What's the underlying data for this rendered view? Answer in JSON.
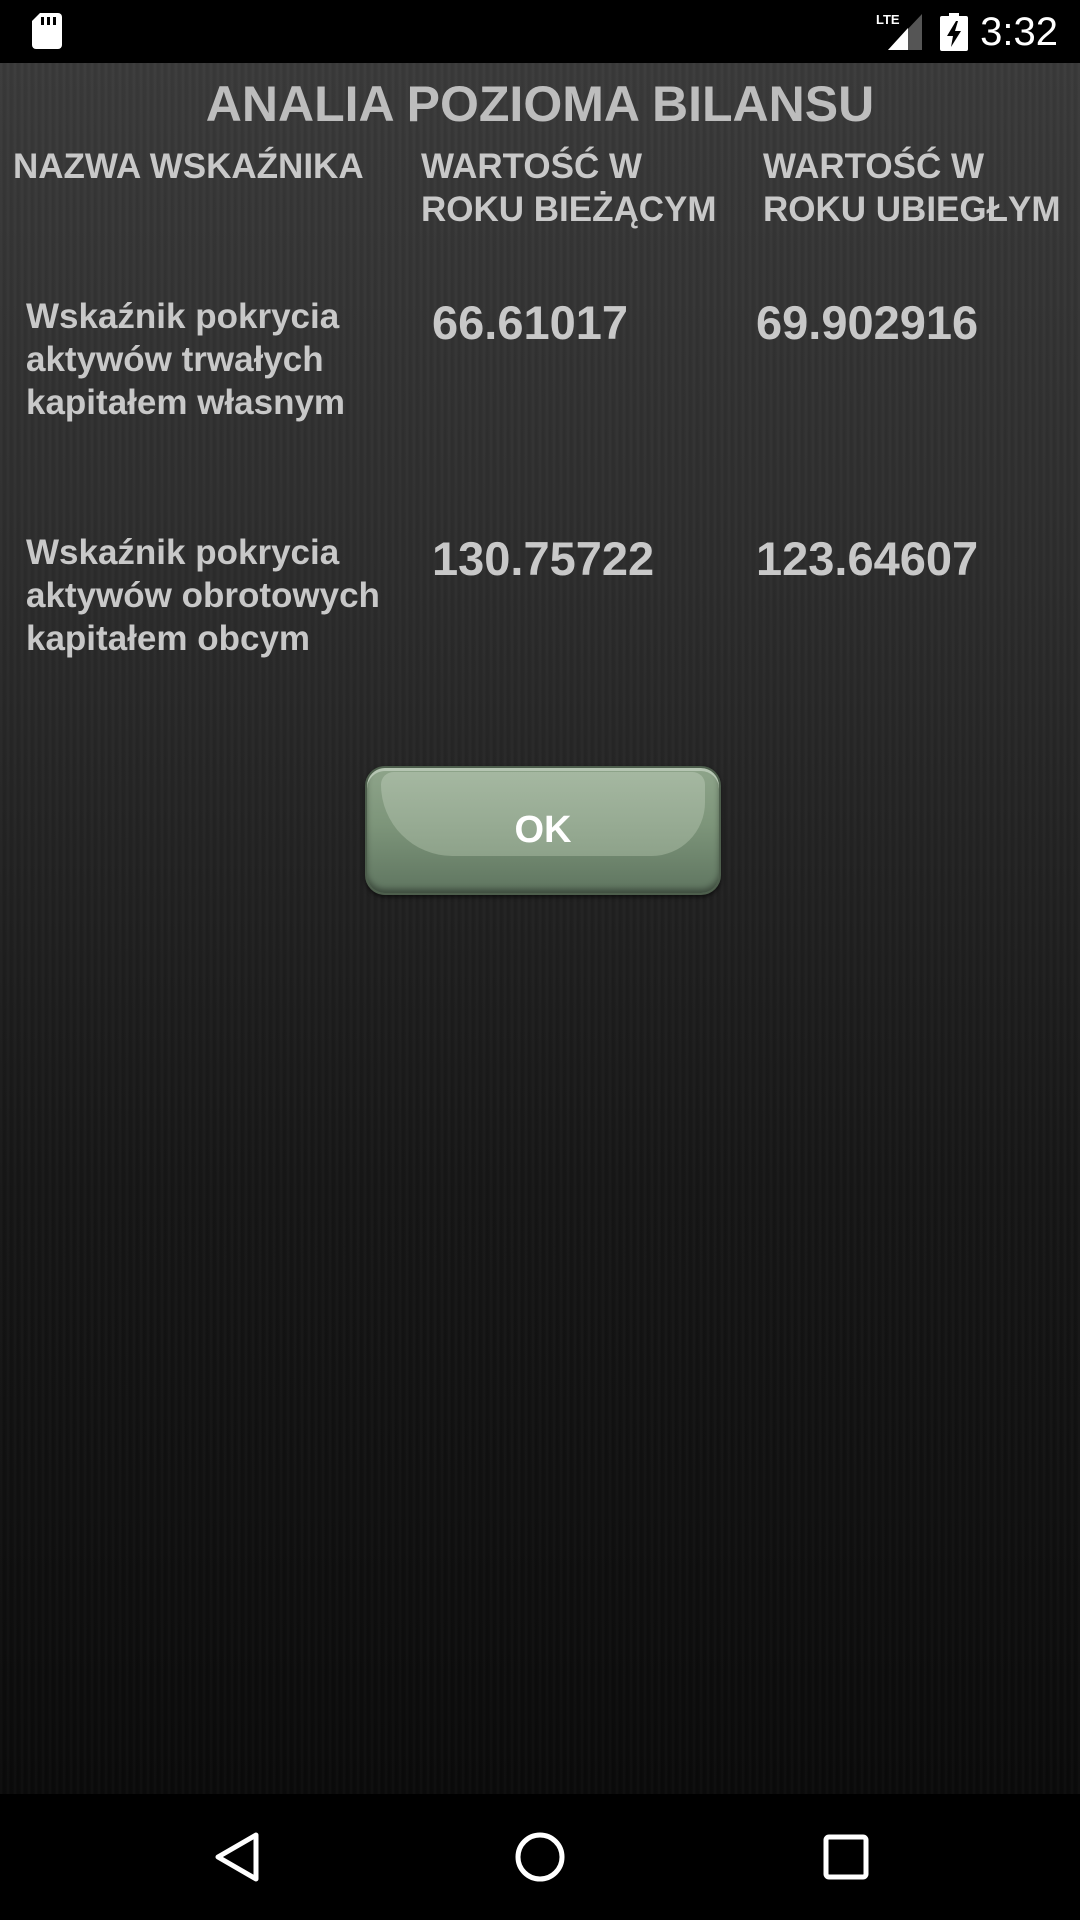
{
  "status_bar": {
    "time": "3:32",
    "network_label": "LTE",
    "icons": [
      "sd-card-icon",
      "signal-icon",
      "battery-charging-icon"
    ]
  },
  "screen": {
    "title": "ANALIA POZIOMA BILANSU",
    "headers": {
      "name": "NAZWA WSKAŹNIKA",
      "current_year": "WARTOŚĆ W ROKU BIEŻĄCYM",
      "previous_year": "WARTOŚĆ W ROKU UBIEGŁYM"
    },
    "rows": [
      {
        "name": "Wskaźnik pokrycia aktywów trwałych kapitałem własnym",
        "current": "66.61017",
        "previous": "69.902916"
      },
      {
        "name": "Wskaźnik pokrycia aktywów obrotowych kapitałem obcym",
        "current": "130.75722",
        "previous": "123.64607"
      }
    ],
    "ok_label": "OK"
  },
  "colors": {
    "text": "#c8c8c8",
    "button": "#7d957a"
  },
  "nav_bar": {
    "icons": [
      "back-icon",
      "home-icon",
      "recent-apps-icon"
    ]
  }
}
